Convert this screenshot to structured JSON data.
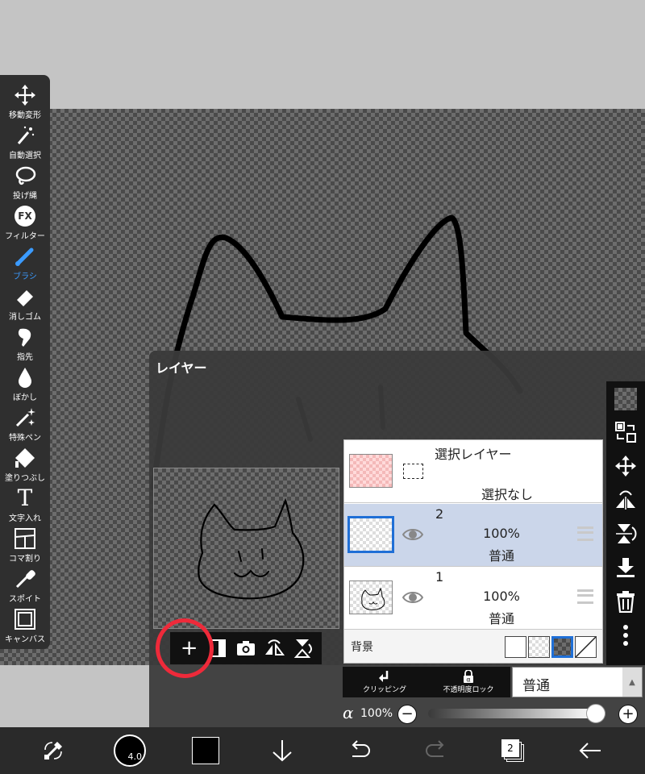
{
  "toolbar": {
    "tools": [
      {
        "label": "移動変形",
        "icon": "move-transform-icon"
      },
      {
        "label": "自動選択",
        "icon": "magic-wand-icon"
      },
      {
        "label": "投げ縄",
        "icon": "lasso-icon"
      },
      {
        "label": "フィルター",
        "icon": "filter-fx-icon"
      },
      {
        "label": "ブラシ",
        "icon": "brush-icon",
        "active": true
      },
      {
        "label": "消しゴム",
        "icon": "eraser-icon"
      },
      {
        "label": "指先",
        "icon": "smudge-icon"
      },
      {
        "label": "ぼかし",
        "icon": "blur-icon"
      },
      {
        "label": "特殊ペン",
        "icon": "special-pen-icon"
      },
      {
        "label": "塗りつぶし",
        "icon": "fill-bucket-icon"
      },
      {
        "label": "文字入れ",
        "icon": "text-icon"
      },
      {
        "label": "コマ割り",
        "icon": "panel-divide-icon"
      },
      {
        "label": "スポイト",
        "icon": "eyedropper-icon"
      },
      {
        "label": "キャンバス",
        "icon": "canvas-icon"
      }
    ],
    "fx_glyph": "FX",
    "text_glyph": "T",
    "active_color": "#3b9bff"
  },
  "layer_panel": {
    "title": "レイヤー",
    "selection_layer": {
      "title": "選択レイヤー",
      "status": "選択なし"
    },
    "layers": [
      {
        "number": "2",
        "opacity": "100%",
        "mode": "普通",
        "selected": true
      },
      {
        "number": "1",
        "opacity": "100%",
        "mode": "普通",
        "selected": false
      }
    ],
    "background": {
      "label": "背景",
      "options": [
        "white",
        "light-checker",
        "dark-checker",
        "none"
      ],
      "selected": "dark-checker"
    },
    "clipping_label": "クリッピング",
    "alpha_lock_label": "不透明度ロック",
    "blend_mode": "普通",
    "alpha": {
      "symbol": "α",
      "value": "100%",
      "level": 1.0
    },
    "minus_glyph": "−",
    "plus_glyph": "+",
    "select_arrow": "▲",
    "preview_tools": [
      "add-layer-icon",
      "add-folder-layer-icon",
      "camera-icon",
      "flip-horizontal-icon",
      "flip-vertical-icon"
    ],
    "add_glyph": "+",
    "right_tools": [
      "transparent-icon",
      "swap-layers-icon",
      "move-layer-icon",
      "flip-h-layer-icon",
      "flip-v-layer-icon",
      "merge-down-icon",
      "trash-icon",
      "more-icon"
    ],
    "highlight_color": "#ee2a3a"
  },
  "bottom_bar": {
    "brush_size": "4.0",
    "color": "#000000",
    "layer_count": "2",
    "items": [
      "swap-tools-icon",
      "brush-size-icon",
      "color-swatch",
      "download-icon",
      "undo-icon",
      "redo-icon",
      "layers-icon",
      "back-icon"
    ]
  }
}
